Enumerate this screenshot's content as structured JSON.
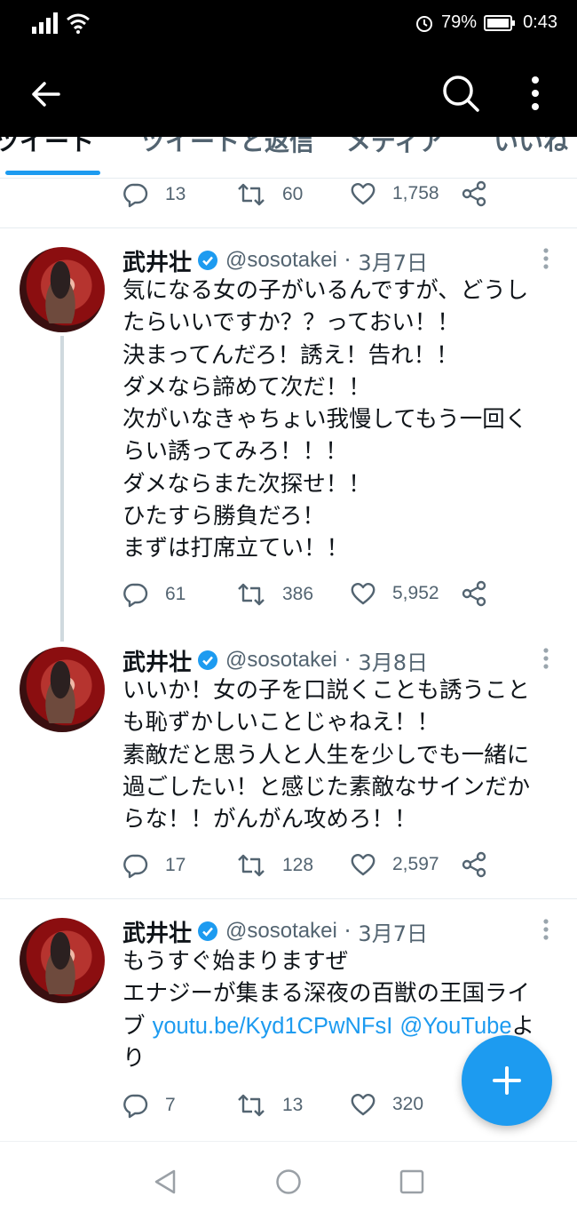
{
  "status_bar": {
    "battery_percent": "79%",
    "time": "0:43",
    "left_icons": [
      "signal-icon",
      "wifi-icon"
    ],
    "right_icons": [
      "alarm-icon",
      "battery-icon"
    ]
  },
  "app_bar": {
    "icons": [
      "back-arrow-icon",
      "search-icon",
      "more-vert-icon"
    ]
  },
  "tabs": [
    {
      "label": "ツイート",
      "active": true
    },
    {
      "label": "ツイートと返信",
      "active": false
    },
    {
      "label": "メディア",
      "active": false
    },
    {
      "label": "いいね",
      "active": false
    }
  ],
  "prev_tweet_actions": {
    "replies": "13",
    "retweets": "60",
    "likes": "1,758"
  },
  "tweets": [
    {
      "name": "武井壮",
      "handle": "@sosotakei",
      "separator": "·",
      "date": "3月7日",
      "lines": [
        "気になる女の子がいるんですが、どうし",
        "たらいいですか？？っておい！！",
        "決まってんだろ！誘え！告れ！！",
        "ダメなら諦めて次だ！！",
        "次がいなきゃちょい我慢してもう一回く",
        "らい誘ってみろ！！！",
        "ダメならまた次探せ！！",
        "ひたすら勝負だろ！",
        "まずは打席立てい！！"
      ],
      "replies": "61",
      "retweets": "386",
      "likes": "5,952"
    },
    {
      "name": "武井壮",
      "handle": "@sosotakei",
      "separator": "·",
      "date": "3月8日",
      "lines": [
        "いいか！女の子を口説くことも誘うこと",
        "も恥ずかしいことじゃねえ！！",
        "素敵だと思う人と人生を少しでも一緒に",
        "過ごしたい！と感じた素敵なサインだか",
        "らな！！がんがん攻めろ！！"
      ],
      "replies": "17",
      "retweets": "128",
      "likes": "2,597"
    },
    {
      "name": "武井壮",
      "handle": "@sosotakei",
      "separator": "·",
      "date": "3月7日",
      "lines": [
        "もうすぐ始まりますぜ",
        "エナジーが集まる深夜の百獣の王国ライ"
      ],
      "line3_prefix": "ブ ",
      "link_url": "youtu.be/Kyd1CPwNFsI",
      "link_mention": "@YouTube",
      "line3_suffix": "よ",
      "line4": "り",
      "replies": "7",
      "retweets": "13",
      "likes": "320"
    }
  ],
  "fab": {
    "icon": "plus-icon"
  },
  "nav_bar": {
    "icons": [
      "back-triangle-icon",
      "home-circle-icon",
      "recents-square-icon"
    ]
  },
  "colors": {
    "accent": "#1d9bf0",
    "text": "#0f1419",
    "muted": "#536471",
    "bar": "#000000"
  }
}
